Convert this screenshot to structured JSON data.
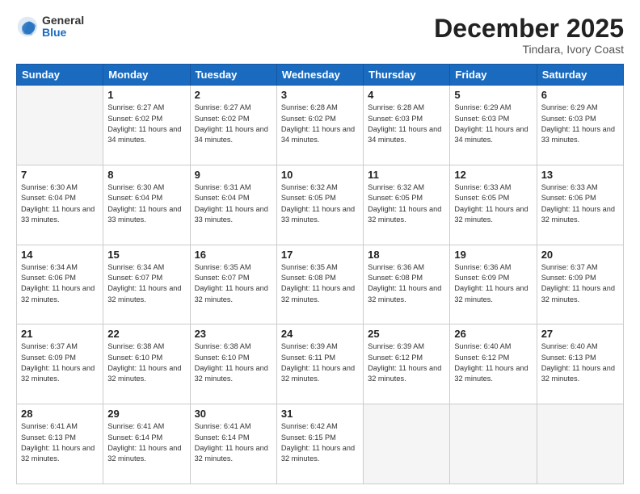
{
  "header": {
    "logo_general": "General",
    "logo_blue": "Blue",
    "month_title": "December 2025",
    "location": "Tindara, Ivory Coast"
  },
  "days_of_week": [
    "Sunday",
    "Monday",
    "Tuesday",
    "Wednesday",
    "Thursday",
    "Friday",
    "Saturday"
  ],
  "weeks": [
    [
      {
        "day": "",
        "info": ""
      },
      {
        "day": "1",
        "info": "Sunrise: 6:27 AM\nSunset: 6:02 PM\nDaylight: 11 hours\nand 34 minutes."
      },
      {
        "day": "2",
        "info": "Sunrise: 6:27 AM\nSunset: 6:02 PM\nDaylight: 11 hours\nand 34 minutes."
      },
      {
        "day": "3",
        "info": "Sunrise: 6:28 AM\nSunset: 6:02 PM\nDaylight: 11 hours\nand 34 minutes."
      },
      {
        "day": "4",
        "info": "Sunrise: 6:28 AM\nSunset: 6:03 PM\nDaylight: 11 hours\nand 34 minutes."
      },
      {
        "day": "5",
        "info": "Sunrise: 6:29 AM\nSunset: 6:03 PM\nDaylight: 11 hours\nand 34 minutes."
      },
      {
        "day": "6",
        "info": "Sunrise: 6:29 AM\nSunset: 6:03 PM\nDaylight: 11 hours\nand 33 minutes."
      }
    ],
    [
      {
        "day": "7",
        "info": "Sunrise: 6:30 AM\nSunset: 6:04 PM\nDaylight: 11 hours\nand 33 minutes."
      },
      {
        "day": "8",
        "info": "Sunrise: 6:30 AM\nSunset: 6:04 PM\nDaylight: 11 hours\nand 33 minutes."
      },
      {
        "day": "9",
        "info": "Sunrise: 6:31 AM\nSunset: 6:04 PM\nDaylight: 11 hours\nand 33 minutes."
      },
      {
        "day": "10",
        "info": "Sunrise: 6:32 AM\nSunset: 6:05 PM\nDaylight: 11 hours\nand 33 minutes."
      },
      {
        "day": "11",
        "info": "Sunrise: 6:32 AM\nSunset: 6:05 PM\nDaylight: 11 hours\nand 32 minutes."
      },
      {
        "day": "12",
        "info": "Sunrise: 6:33 AM\nSunset: 6:05 PM\nDaylight: 11 hours\nand 32 minutes."
      },
      {
        "day": "13",
        "info": "Sunrise: 6:33 AM\nSunset: 6:06 PM\nDaylight: 11 hours\nand 32 minutes."
      }
    ],
    [
      {
        "day": "14",
        "info": "Sunrise: 6:34 AM\nSunset: 6:06 PM\nDaylight: 11 hours\nand 32 minutes."
      },
      {
        "day": "15",
        "info": "Sunrise: 6:34 AM\nSunset: 6:07 PM\nDaylight: 11 hours\nand 32 minutes."
      },
      {
        "day": "16",
        "info": "Sunrise: 6:35 AM\nSunset: 6:07 PM\nDaylight: 11 hours\nand 32 minutes."
      },
      {
        "day": "17",
        "info": "Sunrise: 6:35 AM\nSunset: 6:08 PM\nDaylight: 11 hours\nand 32 minutes."
      },
      {
        "day": "18",
        "info": "Sunrise: 6:36 AM\nSunset: 6:08 PM\nDaylight: 11 hours\nand 32 minutes."
      },
      {
        "day": "19",
        "info": "Sunrise: 6:36 AM\nSunset: 6:09 PM\nDaylight: 11 hours\nand 32 minutes."
      },
      {
        "day": "20",
        "info": "Sunrise: 6:37 AM\nSunset: 6:09 PM\nDaylight: 11 hours\nand 32 minutes."
      }
    ],
    [
      {
        "day": "21",
        "info": "Sunrise: 6:37 AM\nSunset: 6:09 PM\nDaylight: 11 hours\nand 32 minutes."
      },
      {
        "day": "22",
        "info": "Sunrise: 6:38 AM\nSunset: 6:10 PM\nDaylight: 11 hours\nand 32 minutes."
      },
      {
        "day": "23",
        "info": "Sunrise: 6:38 AM\nSunset: 6:10 PM\nDaylight: 11 hours\nand 32 minutes."
      },
      {
        "day": "24",
        "info": "Sunrise: 6:39 AM\nSunset: 6:11 PM\nDaylight: 11 hours\nand 32 minutes."
      },
      {
        "day": "25",
        "info": "Sunrise: 6:39 AM\nSunset: 6:12 PM\nDaylight: 11 hours\nand 32 minutes."
      },
      {
        "day": "26",
        "info": "Sunrise: 6:40 AM\nSunset: 6:12 PM\nDaylight: 11 hours\nand 32 minutes."
      },
      {
        "day": "27",
        "info": "Sunrise: 6:40 AM\nSunset: 6:13 PM\nDaylight: 11 hours\nand 32 minutes."
      }
    ],
    [
      {
        "day": "28",
        "info": "Sunrise: 6:41 AM\nSunset: 6:13 PM\nDaylight: 11 hours\nand 32 minutes."
      },
      {
        "day": "29",
        "info": "Sunrise: 6:41 AM\nSunset: 6:14 PM\nDaylight: 11 hours\nand 32 minutes."
      },
      {
        "day": "30",
        "info": "Sunrise: 6:41 AM\nSunset: 6:14 PM\nDaylight: 11 hours\nand 32 minutes."
      },
      {
        "day": "31",
        "info": "Sunrise: 6:42 AM\nSunset: 6:15 PM\nDaylight: 11 hours\nand 32 minutes."
      },
      {
        "day": "",
        "info": ""
      },
      {
        "day": "",
        "info": ""
      },
      {
        "day": "",
        "info": ""
      }
    ]
  ]
}
